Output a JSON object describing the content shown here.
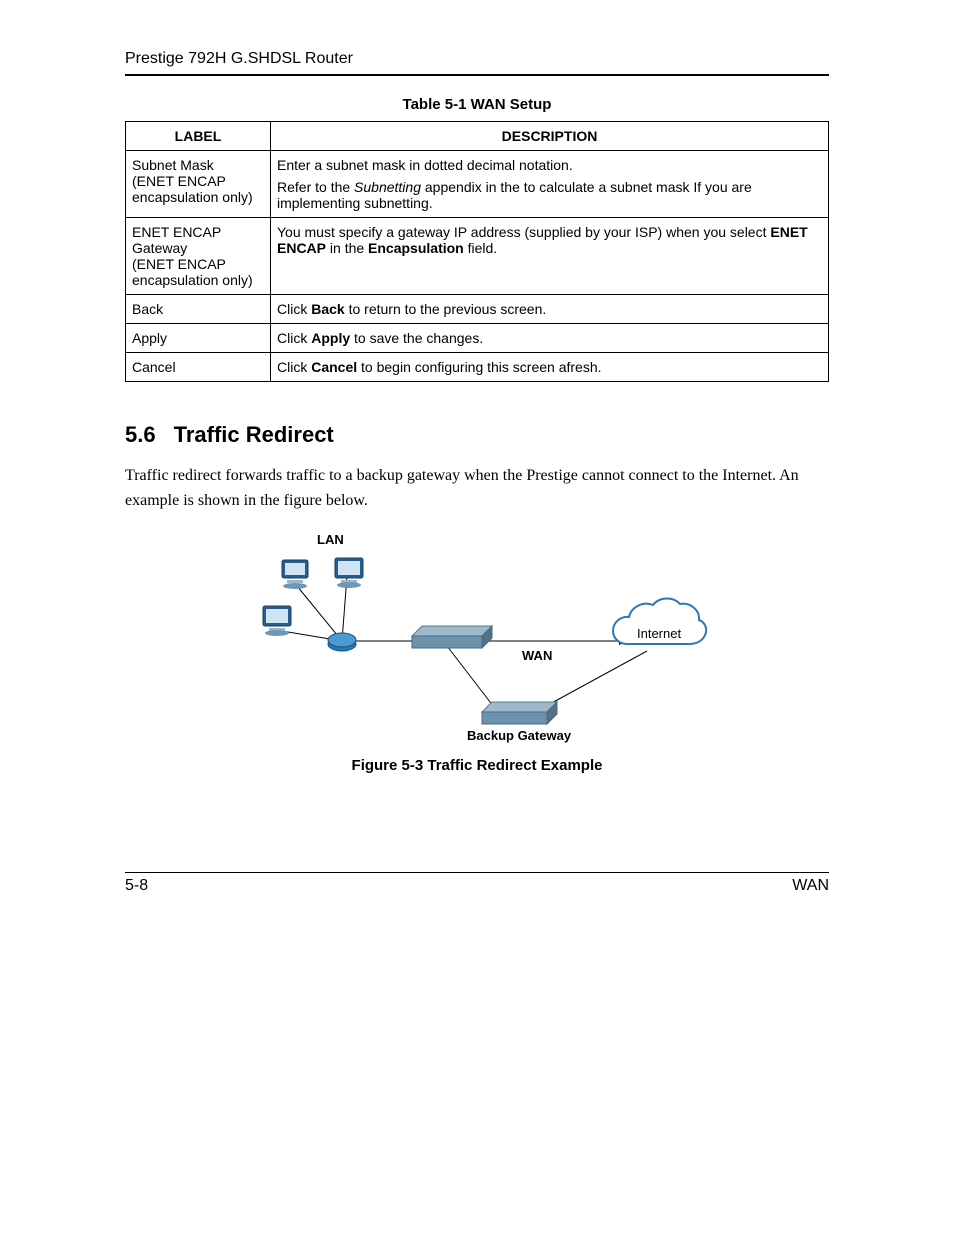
{
  "header": {
    "title": "Prestige 792H G.SHDSL Router"
  },
  "table": {
    "caption": "Table 5-1 WAN Setup",
    "head": {
      "label": "LABEL",
      "description": "DESCRIPTION"
    },
    "rows": [
      {
        "label": "Subnet Mask\n(ENET ENCAP encapsulation only)",
        "desc_line1": "Enter a subnet mask in dotted decimal notation.",
        "desc_line2a": "Refer to the ",
        "desc_line2_italic": "Subnetting",
        "desc_line2b": " appendix in the to calculate a subnet mask If you are implementing subnetting."
      },
      {
        "label": "ENET ENCAP Gateway\n(ENET ENCAP encapsulation only)",
        "desc_a": "You must specify a gateway IP address (supplied by your ISP) when you select ",
        "desc_b1": "ENET ENCAP",
        "desc_c": " in the ",
        "desc_b2": "Encapsulation",
        "desc_d": " field."
      },
      {
        "label": "Back",
        "desc_a": "Click ",
        "desc_b": "Back",
        "desc_c": " to return to the previous screen."
      },
      {
        "label": "Apply",
        "desc_a": "Click ",
        "desc_b": "Apply",
        "desc_c": " to save the changes."
      },
      {
        "label": "Cancel",
        "desc_a": "Click ",
        "desc_b": "Cancel",
        "desc_c": " to begin configuring this screen afresh."
      }
    ]
  },
  "section": {
    "number": "5.6",
    "title": "Traffic Redirect",
    "body": "Traffic redirect forwards traffic to a backup gateway when the Prestige cannot connect to the Internet. An example is shown in the figure below."
  },
  "diagram": {
    "lan": "LAN",
    "wan": "WAN",
    "internet": "Internet",
    "backup": "Backup Gateway"
  },
  "figure_caption": "Figure 5-3 Traffic Redirect Example",
  "footer": {
    "left": "5-8",
    "right": "WAN"
  }
}
